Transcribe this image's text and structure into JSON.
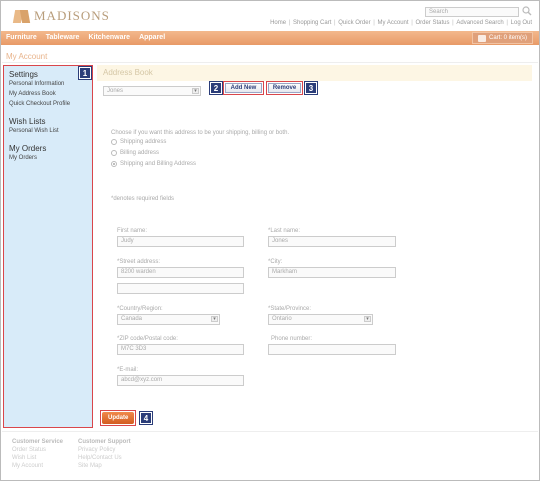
{
  "brand": {
    "name": "MADISONS"
  },
  "search": {
    "placeholder": "Search"
  },
  "toplinks": [
    "Home",
    "Shopping Cart",
    "Quick Order",
    "My Account",
    "Order Status",
    "Advanced Search",
    "Log Out"
  ],
  "nav": {
    "items": [
      "Furniture",
      "Tableware",
      "Kitchenware",
      "Apparel"
    ],
    "cart": "Cart: 0 item(s)"
  },
  "page_title": "My Account",
  "sidebar": {
    "sections": [
      {
        "heading": "Settings",
        "links": [
          "Personal Information",
          "My Address Book",
          "Quick Checkout Profile"
        ]
      },
      {
        "heading": "Wish Lists",
        "links": [
          "Personal Wish List"
        ]
      },
      {
        "heading": "My Orders",
        "links": [
          "My Orders"
        ]
      }
    ]
  },
  "badges": {
    "b1": "1",
    "b2": "2",
    "b3": "3",
    "b4": "4"
  },
  "address_book": {
    "title": "Address Book",
    "selected_address": "Jones",
    "add_new": "Add New",
    "remove": "Remove",
    "question": "Choose if you want this address to be your shipping, billing or both.",
    "options": [
      "Shipping address",
      "Billing address",
      "Shipping and Billing Address"
    ],
    "selected_option": "Shipping and Billing Address",
    "required_note": "*denotes required fields",
    "fields": {
      "first_name": {
        "label": "First name:",
        "value": "Judy"
      },
      "last_name": {
        "label": "*Last name:",
        "value": "Jones"
      },
      "street": {
        "label": "*Street address:",
        "value": "8200 warden",
        "value2": ""
      },
      "city": {
        "label": "*City:",
        "value": "Markham"
      },
      "country": {
        "label": "*Country/Region:",
        "value": "Canada"
      },
      "state": {
        "label": "*State/Province:",
        "value": "Ontario"
      },
      "zip": {
        "label": "*ZIP code/Postal code:",
        "value": "M7C 3D3"
      },
      "phone": {
        "label": "Phone number:",
        "value": ""
      },
      "email": {
        "label": "*E-mail:",
        "value": "abcd@xyz.com"
      }
    },
    "update": "Update"
  },
  "footer": {
    "customer_service": {
      "heading": "Customer Service",
      "links": [
        "Order Status",
        "Wish List",
        "My Account"
      ]
    },
    "customer_support": {
      "heading": "Customer Support",
      "links": [
        "Privacy Policy",
        "Help/Contact Us",
        "Site Map"
      ]
    }
  },
  "colors": {
    "accent": "#e89a67",
    "sidebar_bg": "#d8ebf9",
    "highlight_border": "#d9464b",
    "badge": "#2b3d79"
  }
}
